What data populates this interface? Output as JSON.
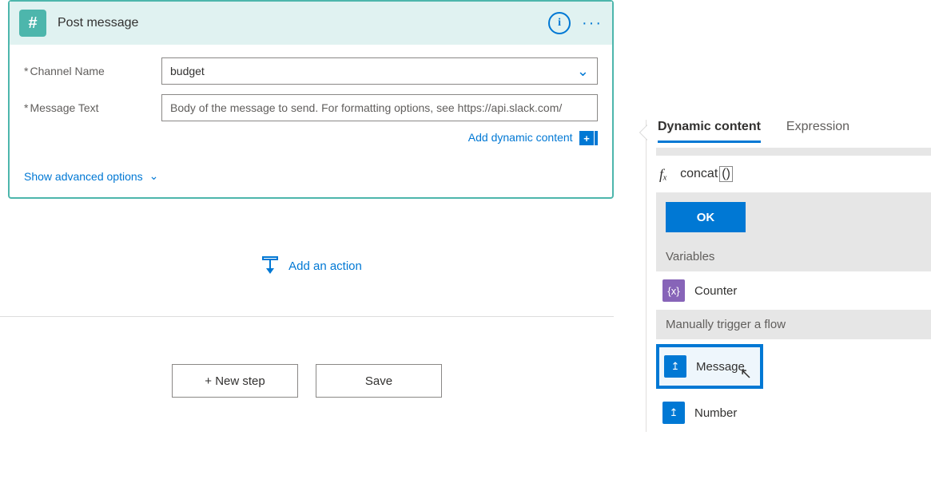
{
  "card": {
    "title": "Post message",
    "icon_glyph": "#",
    "info_icon": "i",
    "more_icon": "···",
    "fields": {
      "channel": {
        "label": "Channel Name",
        "value": "budget"
      },
      "message": {
        "label": "Message Text",
        "placeholder": "Body of the message to send. For formatting options, see https://api.slack.com/"
      }
    },
    "add_dynamic": "Add dynamic content",
    "advanced": "Show advanced options"
  },
  "actions": {
    "add_action": "Add an action",
    "new_step": "+ New step",
    "save": "Save"
  },
  "panel": {
    "tabs": {
      "dynamic": "Dynamic content",
      "expression": "Expression"
    },
    "fx_label": "fₓ",
    "expression": "concat",
    "paren": "()",
    "ok": "OK",
    "sections": {
      "variables": {
        "title": "Variables",
        "items": [
          "Counter"
        ]
      },
      "trigger": {
        "title": "Manually trigger a flow",
        "items": [
          "Message",
          "Number"
        ]
      }
    },
    "tile_glyphs": {
      "variable": "{x}",
      "param": "↥"
    }
  }
}
